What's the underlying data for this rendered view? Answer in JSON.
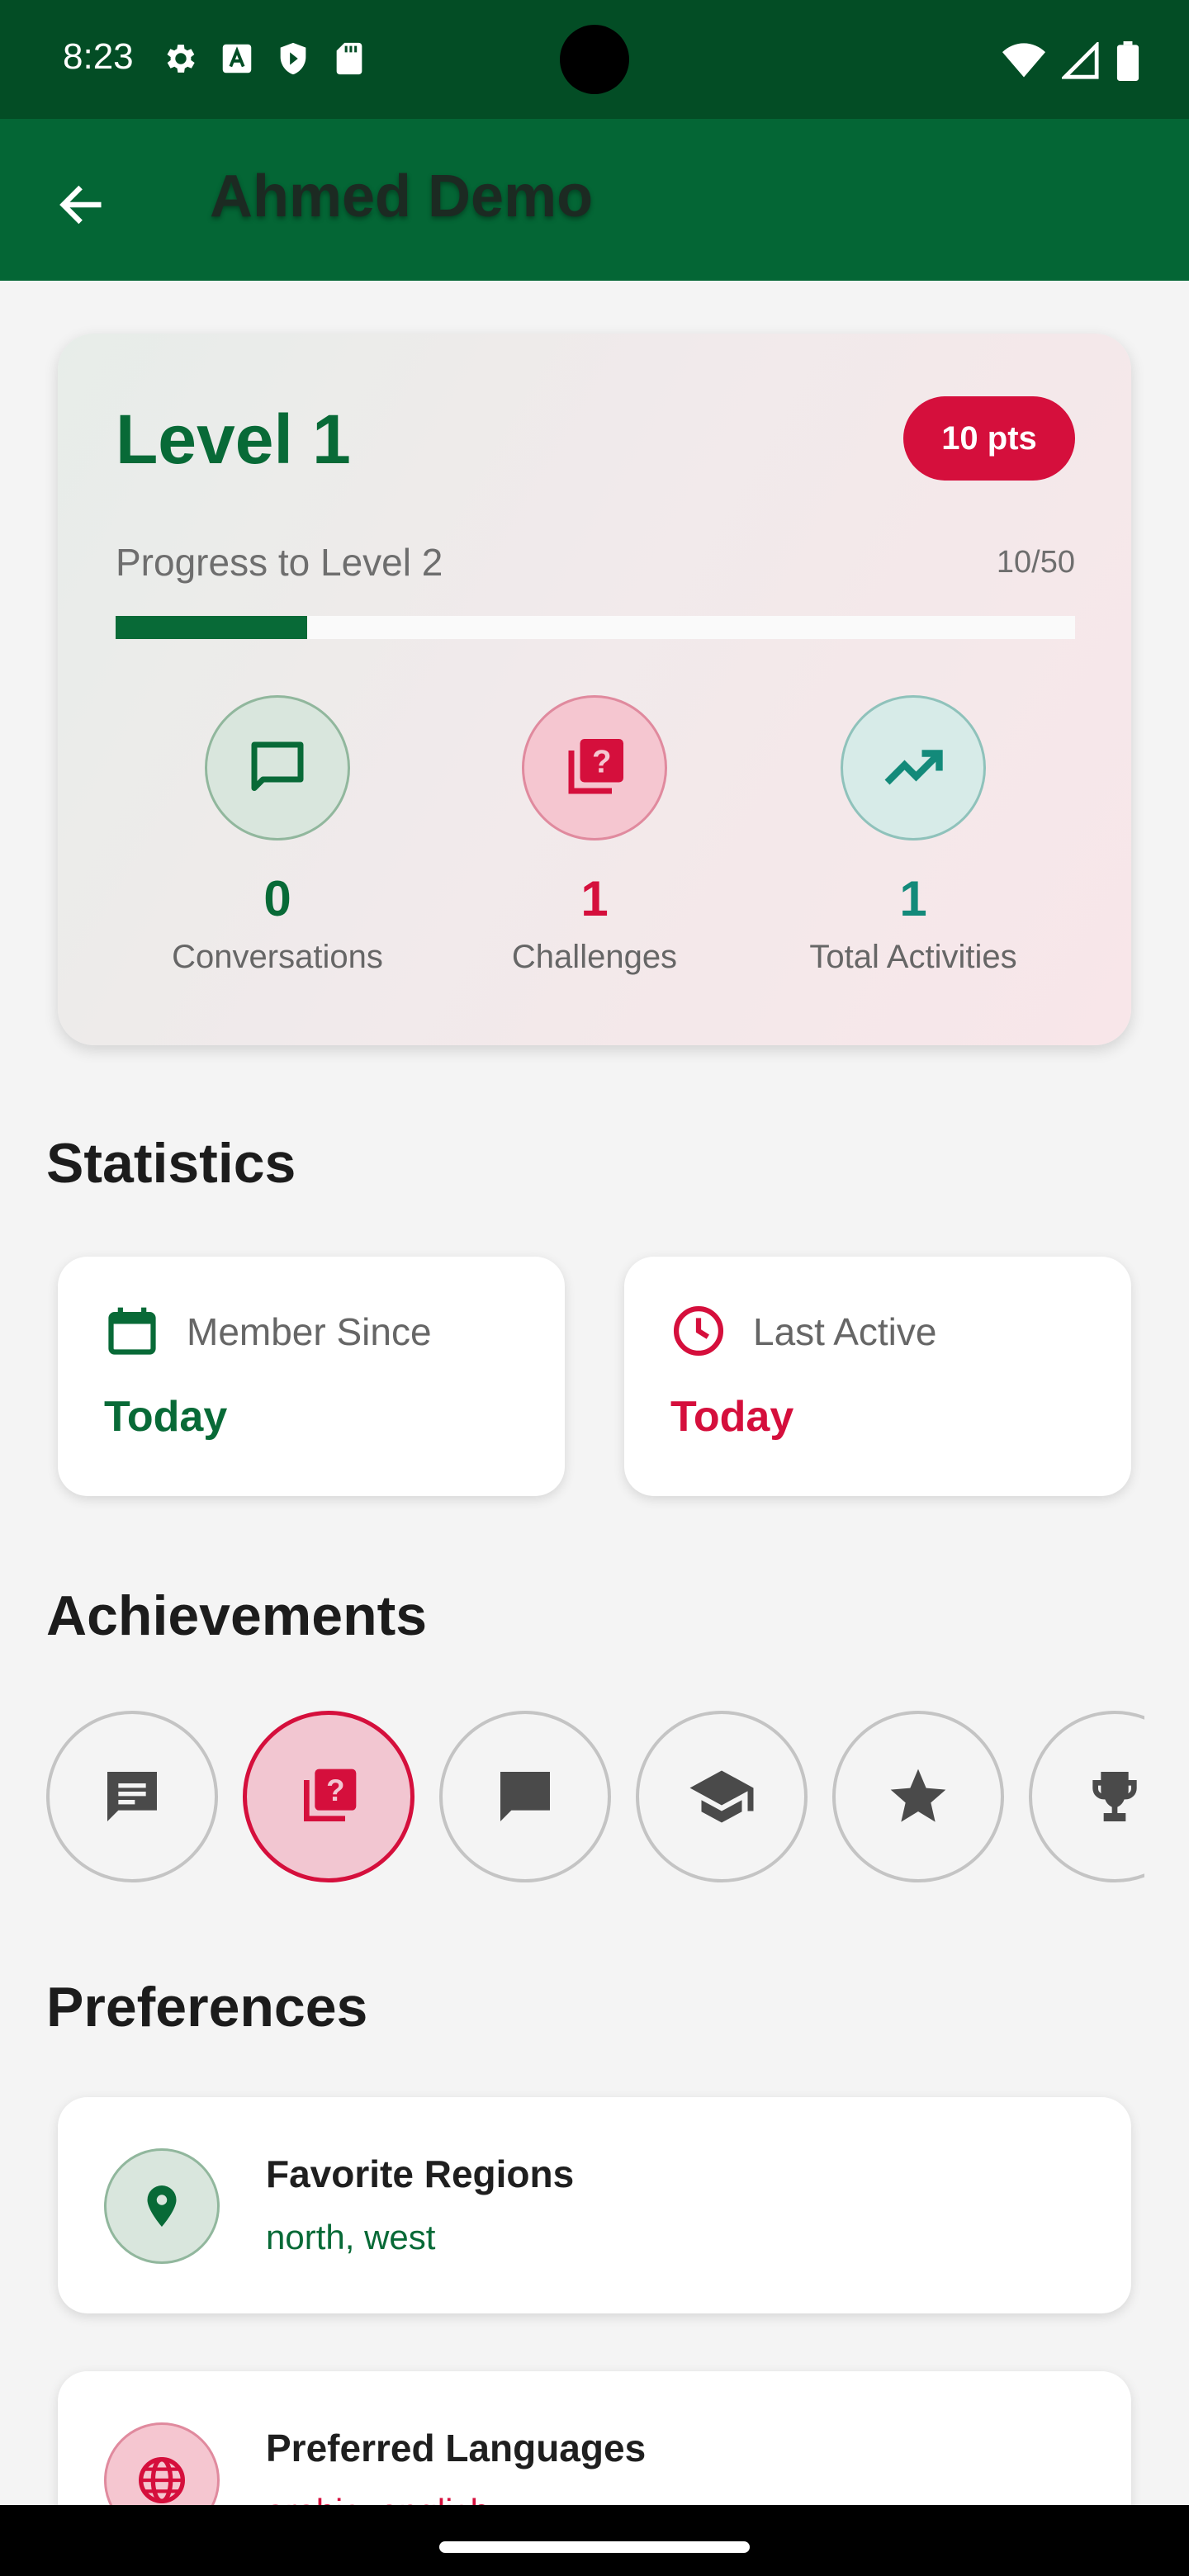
{
  "status_bar": {
    "time": "8:23",
    "icons_left": [
      "settings-icon",
      "text-a-icon",
      "shield-icon",
      "sd-card-icon"
    ],
    "icons_right": [
      "wifi-icon",
      "signal-icon",
      "battery-icon"
    ]
  },
  "app_bar": {
    "title": "Ahmed Demo",
    "back_icon": "arrow-left-icon",
    "color": "#046635"
  },
  "level_card": {
    "level_title": "Level 1",
    "points_badge": "10 pts",
    "progress_label": "Progress to Level 2",
    "progress_count": "10/50",
    "progress_fraction": 0.2,
    "stats": [
      {
        "value": "0",
        "label": "Conversations",
        "icon": "chat-bubble-icon",
        "color": "#086a37"
      },
      {
        "value": "1",
        "label": "Challenges",
        "icon": "quiz-icon",
        "color": "#d50f3c"
      },
      {
        "value": "1",
        "label": "Total Activities",
        "icon": "trending-up-icon",
        "color": "#138a7a"
      }
    ]
  },
  "statistics": {
    "title": "Statistics",
    "cards": [
      {
        "label": "Member Since",
        "value": "Today",
        "icon": "calendar-icon",
        "color": "#086a37"
      },
      {
        "label": "Last Active",
        "value": "Today",
        "icon": "clock-icon",
        "color": "#d50f3c"
      }
    ]
  },
  "achievements": {
    "title": "Achievements",
    "badges": [
      {
        "icon": "message-icon",
        "active": false
      },
      {
        "icon": "quiz-icon",
        "active": true
      },
      {
        "icon": "chat-bubble-filled-icon",
        "active": false
      },
      {
        "icon": "graduation-cap-icon",
        "active": false
      },
      {
        "icon": "star-icon",
        "active": false
      },
      {
        "icon": "trophy-icon",
        "active": false
      }
    ]
  },
  "preferences": {
    "title": "Preferences",
    "items": [
      {
        "title": "Favorite Regions",
        "value": "north, west",
        "icon": "location-pin-icon",
        "color": "#086a37"
      },
      {
        "title": "Preferred Languages",
        "value": "arabic, english",
        "icon": "globe-icon",
        "color": "#d50f3c"
      }
    ]
  },
  "colors": {
    "primary_green": "#086a37",
    "accent_red": "#d50f3c",
    "teal": "#138a7a",
    "status_bar": "#034d25"
  }
}
